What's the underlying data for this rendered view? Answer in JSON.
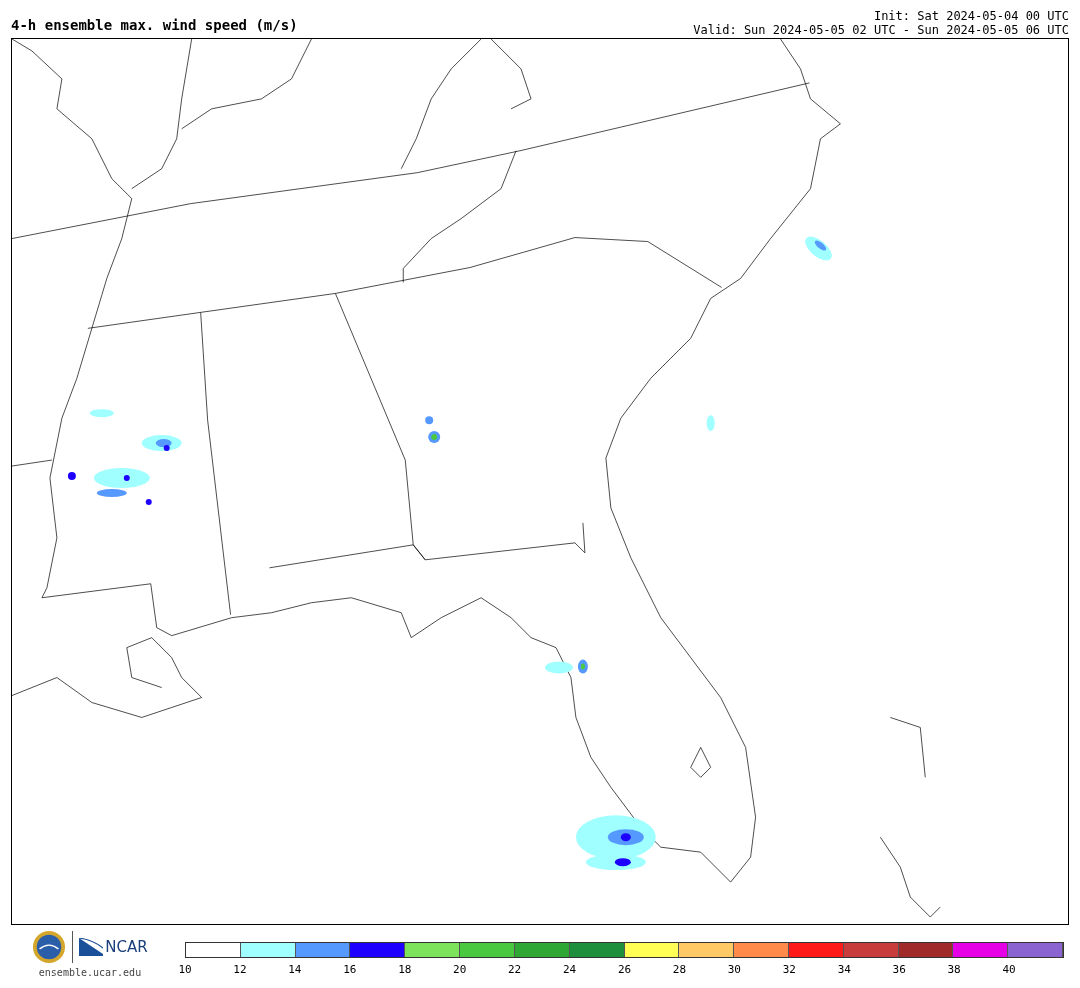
{
  "header": {
    "title": "4-h ensemble max. wind speed (m/s)",
    "init": "Init: Sat 2024-05-04 00 UTC",
    "valid": "Valid: Sun 2024-05-05 02 UTC - Sun 2024-05-05 06 UTC"
  },
  "footer": {
    "logo_text": "NCAR",
    "url": "ensemble.ucar.edu"
  },
  "legend": {
    "bins": [
      {
        "color": "#ffffff"
      },
      {
        "color": "#a0ffff"
      },
      {
        "color": "#5599ff"
      },
      {
        "color": "#1e00ff"
      },
      {
        "color": "#7de35a"
      },
      {
        "color": "#4ac83f"
      },
      {
        "color": "#2fa734"
      },
      {
        "color": "#1e8f3c"
      },
      {
        "color": "#ffff55"
      },
      {
        "color": "#ffc966"
      },
      {
        "color": "#ff8a4a"
      },
      {
        "color": "#ff1a1a"
      },
      {
        "color": "#c83c3c"
      },
      {
        "color": "#a02a2a"
      },
      {
        "color": "#e600e6"
      },
      {
        "color": "#8c64d2"
      }
    ],
    "ticks": [
      "10",
      "12",
      "14",
      "16",
      "18",
      "20",
      "22",
      "24",
      "26",
      "28",
      "30",
      "32",
      "34",
      "36",
      "38",
      "40"
    ]
  }
}
